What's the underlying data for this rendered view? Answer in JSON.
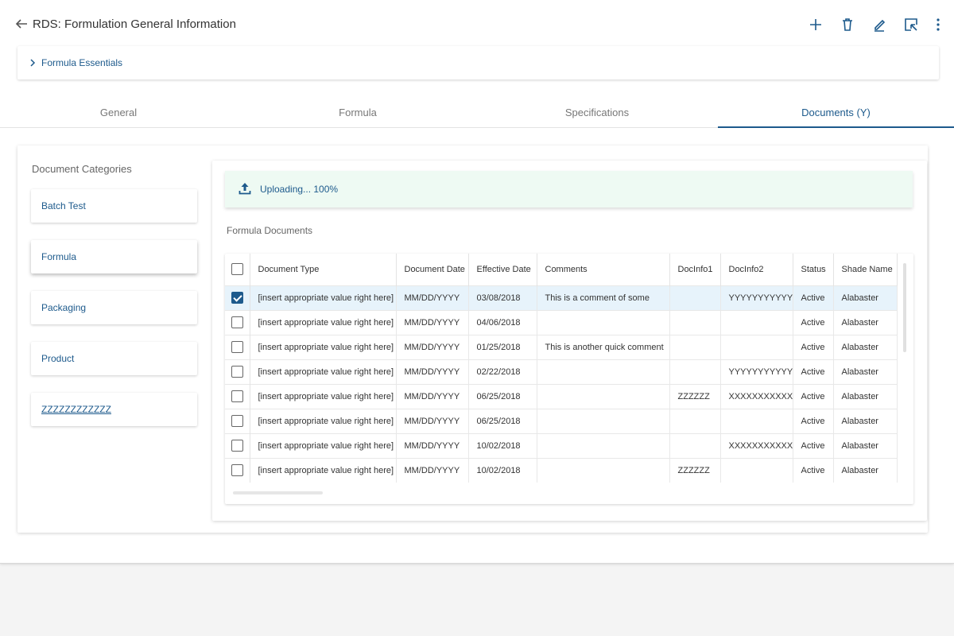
{
  "header": {
    "title": "RDS: Formulation General Information"
  },
  "essentials": {
    "label": "Formula Essentials"
  },
  "tabs": [
    {
      "label": "General"
    },
    {
      "label": "Formula"
    },
    {
      "label": "Specifications"
    },
    {
      "label": "Documents (Y)"
    }
  ],
  "categories": {
    "title": "Document Categories",
    "items": [
      {
        "label": "Batch Test"
      },
      {
        "label": "Formula"
      },
      {
        "label": "Packaging"
      },
      {
        "label": "Product"
      },
      {
        "label": "ZZZZZZZZZZZZ"
      }
    ]
  },
  "upload": {
    "text": "Uploading... 100%",
    "progress": 100
  },
  "documents": {
    "title": "Formula Documents",
    "columns": [
      "Document Type",
      "Document Date",
      "Effective Date",
      "Comments",
      "DocInfo1",
      "DocInfo2",
      "Status",
      "Shade Name"
    ],
    "rows": [
      {
        "checked": true,
        "cells": [
          "[insert appropriate value right here]",
          "MM/DD/YYYY",
          "03/08/2018",
          "This is a comment of some",
          "",
          "YYYYYYYYYYY",
          "Active",
          "Alabaster"
        ]
      },
      {
        "checked": false,
        "cells": [
          "[insert appropriate value right here]",
          "MM/DD/YYYY",
          "04/06/2018",
          "",
          "",
          "",
          "Active",
          "Alabaster"
        ]
      },
      {
        "checked": false,
        "cells": [
          "[insert appropriate value right here]",
          "MM/DD/YYYY",
          "01/25/2018",
          "This is another quick comment",
          "",
          "",
          "Active",
          "Alabaster"
        ]
      },
      {
        "checked": false,
        "cells": [
          "[insert appropriate value right here]",
          "MM/DD/YYYY",
          "02/22/2018",
          "",
          "",
          "YYYYYYYYYYY",
          "Active",
          "Alabaster"
        ]
      },
      {
        "checked": false,
        "cells": [
          "[insert appropriate value right here]",
          "MM/DD/YYYY",
          "06/25/2018",
          "",
          "ZZZZZZ",
          "XXXXXXXXXXX",
          "Active",
          "Alabaster"
        ]
      },
      {
        "checked": false,
        "cells": [
          "[insert appropriate value right here]",
          "MM/DD/YYYY",
          "06/25/2018",
          "",
          "",
          "",
          "Active",
          "Alabaster"
        ]
      },
      {
        "checked": false,
        "cells": [
          "[insert appropriate value right here]",
          "MM/DD/YYYY",
          "10/02/2018",
          "",
          "",
          "XXXXXXXXXXX",
          "Active",
          "Alabaster"
        ]
      },
      {
        "checked": false,
        "cells": [
          "[insert appropriate value right here]",
          "MM/DD/YYYY",
          "10/02/2018",
          "",
          "ZZZZZZ",
          "",
          "Active",
          "Alabaster"
        ]
      }
    ]
  },
  "colors": {
    "accent": "#1d5a8c",
    "upload_bg": "#eefaf3",
    "selected_row": "#e7f3fb"
  }
}
